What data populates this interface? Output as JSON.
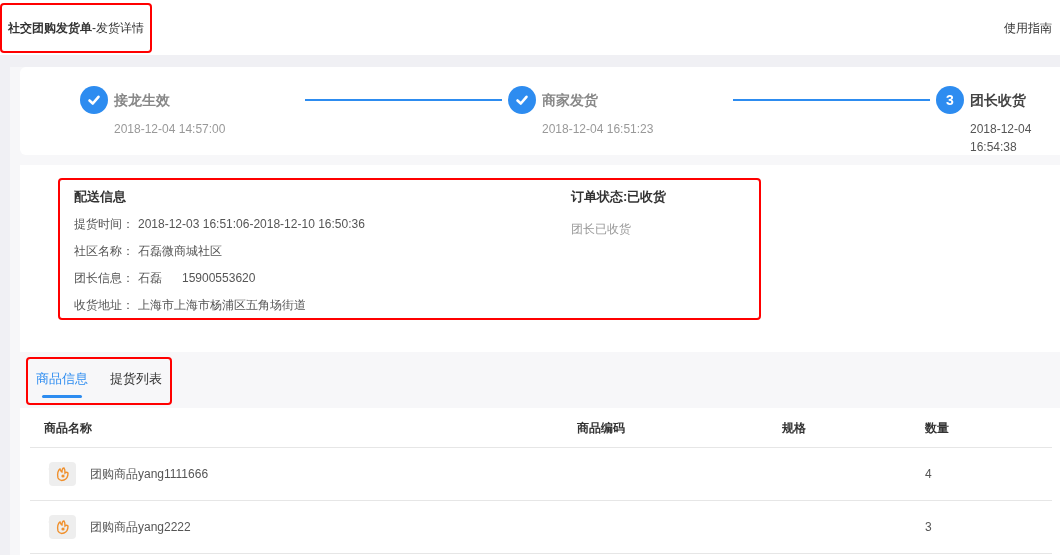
{
  "header": {
    "title": {
      "main": "社交团购发货单",
      "sub": "-发货详情"
    },
    "highlighted": true,
    "guide_link": "使用指南"
  },
  "steps": [
    {
      "kind": "done",
      "title": "接龙生效",
      "time": "2018-12-04 14:57:00"
    },
    {
      "kind": "done",
      "title": "商家发货",
      "time": "2018-12-04 16:51:23"
    },
    {
      "kind": "current",
      "number": "3",
      "title": "团长收货",
      "time": "2018-12-04 16:54:38"
    }
  ],
  "delivery": {
    "highlighted": true,
    "title": "配送信息",
    "fields": [
      {
        "label": "提货时间：",
        "value": "2018-12-03 16:51:06-2018-12-10 16:50:36"
      },
      {
        "label": "社区名称：",
        "value": "石磊微商城社区"
      },
      {
        "label": "团长信息：",
        "value": "石磊",
        "extra": "15900553620"
      },
      {
        "label": "收货地址：",
        "value": "上海市上海市杨浦区五角场街道"
      }
    ],
    "status_title": "订单状态:已收货",
    "status_text": "团长已收货"
  },
  "tabs_highlighted": true,
  "tabs": [
    {
      "label": "商品信息",
      "selected": true
    },
    {
      "label": "提货列表",
      "selected": false
    }
  ],
  "table": {
    "columns": [
      "商品名称",
      "商品编码",
      "规格",
      "数量"
    ],
    "rows": [
      {
        "name": "团购商品yang1111666",
        "quantity": "4"
      },
      {
        "name": "团购商品yang2222",
        "quantity": "3"
      }
    ]
  }
}
